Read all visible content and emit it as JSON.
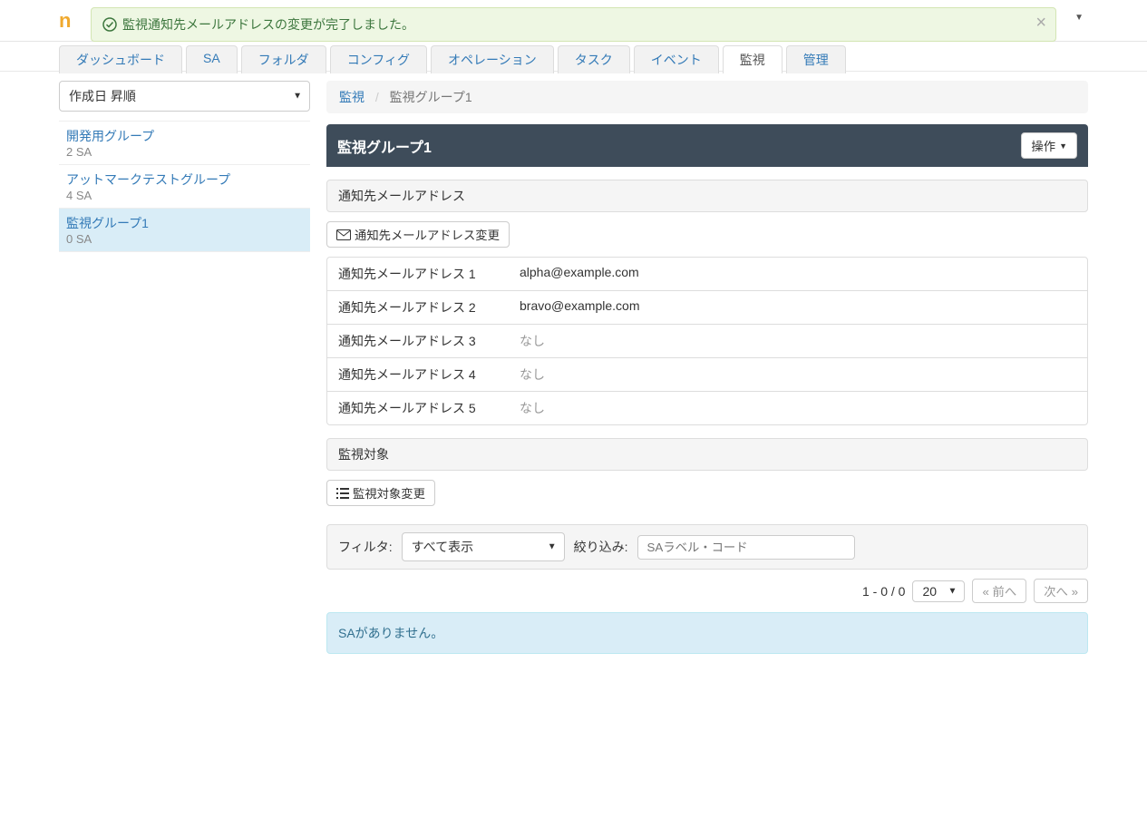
{
  "alert": {
    "text": "監視通知先メールアドレスの変更が完了しました。"
  },
  "logo": "n",
  "nav": {
    "items": [
      {
        "label": "ダッシュボード",
        "active": false
      },
      {
        "label": "SA",
        "active": false
      },
      {
        "label": "フォルダ",
        "active": false
      },
      {
        "label": "コンフィグ",
        "active": false
      },
      {
        "label": "オペレーション",
        "active": false
      },
      {
        "label": "タスク",
        "active": false
      },
      {
        "label": "イベント",
        "active": false
      },
      {
        "label": "監視",
        "active": true
      },
      {
        "label": "管理",
        "active": false
      }
    ]
  },
  "sidebar": {
    "sort": "作成日 昇順",
    "groups": [
      {
        "name": "開発用グループ",
        "count": "2 SA",
        "selected": false
      },
      {
        "name": "アットマークテストグループ",
        "count": "4 SA",
        "selected": false
      },
      {
        "name": "監視グループ1",
        "count": "0 SA",
        "selected": true
      }
    ]
  },
  "breadcrumb": {
    "root": "監視",
    "current": "監視グループ1"
  },
  "panel": {
    "title": "監視グループ1",
    "action_label": "操作"
  },
  "email_section": {
    "title": "通知先メールアドレス",
    "change_button": "通知先メールアドレス変更",
    "rows": [
      {
        "label": "通知先メールアドレス 1",
        "value": "alpha@example.com",
        "muted": false
      },
      {
        "label": "通知先メールアドレス 2",
        "value": "bravo@example.com",
        "muted": false
      },
      {
        "label": "通知先メールアドレス 3",
        "value": "なし",
        "muted": true
      },
      {
        "label": "通知先メールアドレス 4",
        "value": "なし",
        "muted": true
      },
      {
        "label": "通知先メールアドレス 5",
        "value": "なし",
        "muted": true
      }
    ]
  },
  "target_section": {
    "title": "監視対象",
    "change_button": "監視対象変更"
  },
  "filter": {
    "label": "フィルタ:",
    "select_value": "すべて表示",
    "narrow_label": "絞り込み:",
    "placeholder": "SAラベル・コード"
  },
  "pager": {
    "range": "1 - 0 / 0",
    "page_size": "20",
    "prev": "« 前へ",
    "next": "次へ »"
  },
  "empty": {
    "message": "SAがありません。"
  }
}
